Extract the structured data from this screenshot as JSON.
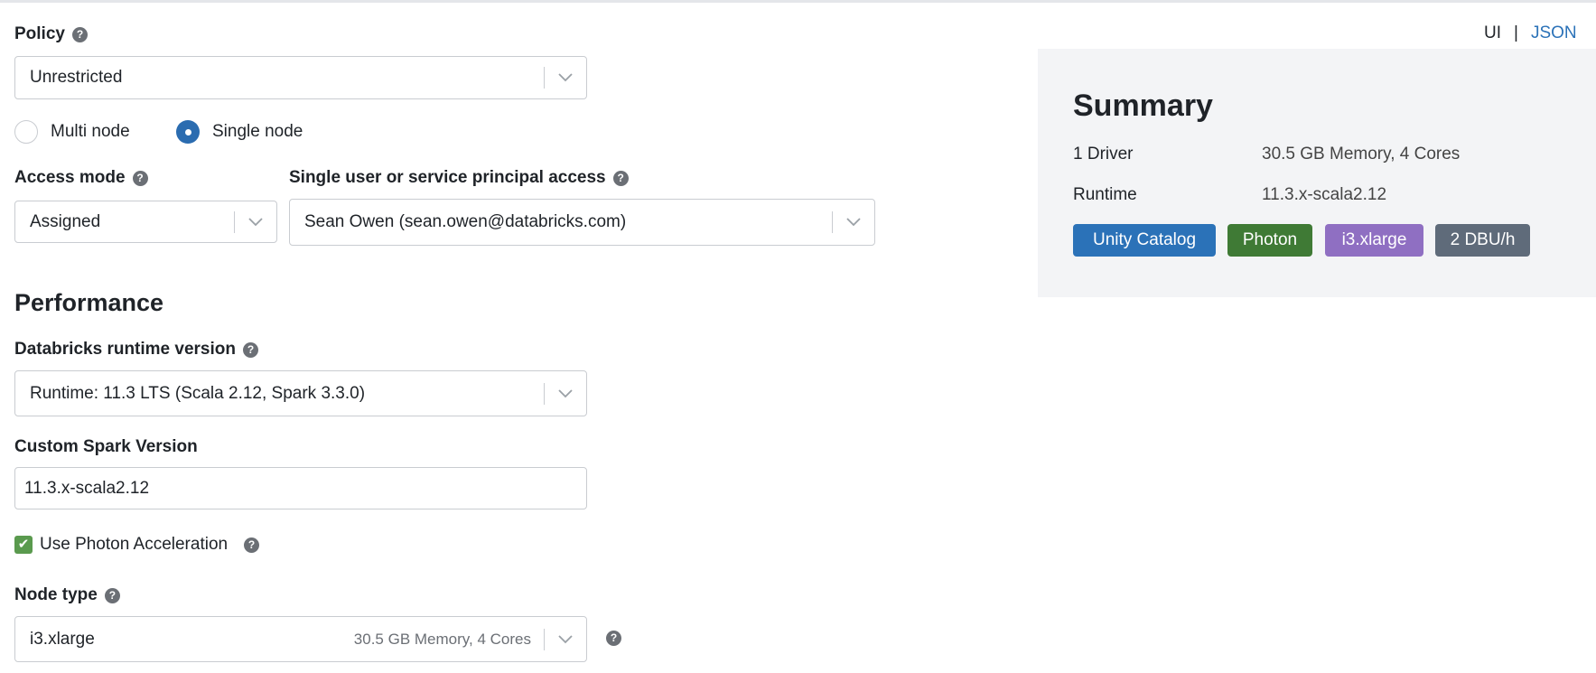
{
  "view_toggle": {
    "ui": "UI",
    "separator": "|",
    "json": "JSON"
  },
  "policy": {
    "label": "Policy",
    "value": "Unrestricted"
  },
  "node_mode": {
    "options": [
      {
        "label": "Multi node",
        "selected": false
      },
      {
        "label": "Single node",
        "selected": true
      }
    ]
  },
  "access_mode": {
    "label": "Access mode",
    "value": "Assigned"
  },
  "single_user": {
    "label": "Single user or service principal access",
    "value": "Sean Owen (sean.owen@databricks.com)"
  },
  "performance": {
    "heading": "Performance"
  },
  "runtime": {
    "label": "Databricks runtime version",
    "value": "Runtime: 11.3 LTS (Scala 2.12, Spark 3.3.0)"
  },
  "custom_spark": {
    "label": "Custom Spark Version",
    "value": "11.3.x-scala2.12"
  },
  "photon": {
    "label": "Use Photon Acceleration",
    "checked": true
  },
  "node_type": {
    "label": "Node type",
    "value": "i3.xlarge",
    "detail": "30.5 GB Memory, 4 Cores"
  },
  "summary": {
    "title": "Summary",
    "rows": [
      {
        "key": "1 Driver",
        "value": "30.5 GB Memory, 4 Cores"
      },
      {
        "key": "Runtime",
        "value": "11.3.x-scala2.12"
      }
    ],
    "badges": [
      {
        "label": "Unity Catalog",
        "color": "#2b72b8"
      },
      {
        "label": "Photon",
        "color": "#3f7a35"
      },
      {
        "label": "i3.xlarge",
        "color": "#8f6fc2"
      },
      {
        "label": "2 DBU/h",
        "color": "#5f6b7a"
      }
    ]
  }
}
